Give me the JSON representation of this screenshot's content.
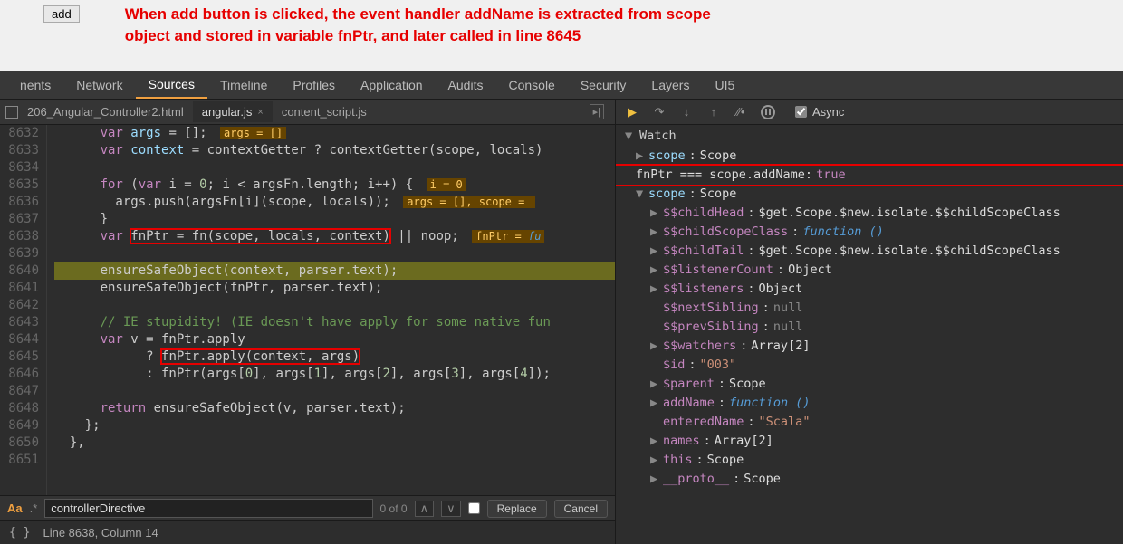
{
  "topbar": {
    "add_button": "add",
    "annotation_line1": "When add button is clicked, the event handler addName is extracted from scope",
    "annotation_line2": "object and stored in variable fnPtr, and later called in line 8645"
  },
  "devtools_tabs": [
    "nents",
    "Network",
    "Sources",
    "Timeline",
    "Profiles",
    "Application",
    "Audits",
    "Console",
    "Security",
    "Layers",
    "UI5"
  ],
  "active_tab": "Sources",
  "file_tabs": {
    "file0": "206_Angular_Controller2.html",
    "file1": "angular.js",
    "file2": "content_script.js",
    "active": "angular.js"
  },
  "line_numbers": [
    "8632",
    "8633",
    "8634",
    "8635",
    "8636",
    "8637",
    "8638",
    "8639",
    "8640",
    "8641",
    "8642",
    "8643",
    "8644",
    "8645",
    "8646",
    "8647",
    "8648",
    "8649",
    "8650",
    "8651"
  ],
  "code": {
    "l8632": "      var args = [];   args = []",
    "l8633": "      var context = contextGetter ? contextGetter(scope, locals)",
    "l8634": "",
    "l8635_a": "      for (var i = 0; i < argsFn.length; i++) {",
    "l8635_hint": "i = 0",
    "l8636_a": "        args.push(argsFn[i](scope, locals));",
    "l8636_hint": "args = [], scope =",
    "l8637": "      }",
    "l8638_a": "      var ",
    "l8638_b": "fnPtr = fn(scope, locals, context)",
    "l8638_c": " || noop;",
    "l8638_hint": "fnPtr = fu",
    "l8639": "",
    "l8640": "      ensureSafeObject(context, parser.text);",
    "l8641": "      ensureSafeObject(fnPtr, parser.text);",
    "l8642": "",
    "l8643": "      // IE stupidity! (IE doesn't have apply for some native fun",
    "l8644": "      var v = fnPtr.apply",
    "l8645_a": "            ? ",
    "l8645_b": "fnPtr.apply(context, args)",
    "l8646": "            : fnPtr(args[0], args[1], args[2], args[3], args[4]);",
    "l8647": "",
    "l8648": "      return ensureSafeObject(v, parser.text);",
    "l8649": "    };",
    "l8650": "  },",
    "l8651": ""
  },
  "search": {
    "value": "controllerDirective",
    "count": "0 of 0",
    "replace_label": "Replace",
    "cancel_label": "Cancel"
  },
  "status": "Line 8638, Column 14",
  "debug": {
    "async_label": "Async",
    "watch_label": "Watch"
  },
  "watch": {
    "w0": {
      "name": "scope",
      "val": "Scope"
    },
    "w1": {
      "expr": "fnPtr === scope.addName:",
      "val": "true"
    },
    "w2": {
      "name": "scope",
      "val": "Scope"
    },
    "p_childHead": {
      "name": "$$childHead",
      "val": "$get.Scope.$new.isolate.$$childScopeClass"
    },
    "p_childScopeClass": {
      "name": "$$childScopeClass",
      "val": "function ()"
    },
    "p_childTail": {
      "name": "$$childTail",
      "val": "$get.Scope.$new.isolate.$$childScopeClass"
    },
    "p_listenerCount": {
      "name": "$$listenerCount",
      "val": "Object"
    },
    "p_listeners": {
      "name": "$$listeners",
      "val": "Object"
    },
    "p_nextSibling": {
      "name": "$$nextSibling",
      "val": "null"
    },
    "p_prevSibling": {
      "name": "$$prevSibling",
      "val": "null"
    },
    "p_watchers": {
      "name": "$$watchers",
      "val": "Array[2]"
    },
    "p_id": {
      "name": "$id",
      "val": "\"003\""
    },
    "p_parent": {
      "name": "$parent",
      "val": "Scope"
    },
    "p_addName": {
      "name": "addName",
      "val": "function ()"
    },
    "p_enteredName": {
      "name": "enteredName",
      "val": "\"Scala\""
    },
    "p_names": {
      "name": "names",
      "val": "Array[2]"
    },
    "p_this": {
      "name": "this",
      "val": "Scope"
    },
    "p_proto": {
      "name": "__proto__",
      "val": "Scope"
    }
  }
}
